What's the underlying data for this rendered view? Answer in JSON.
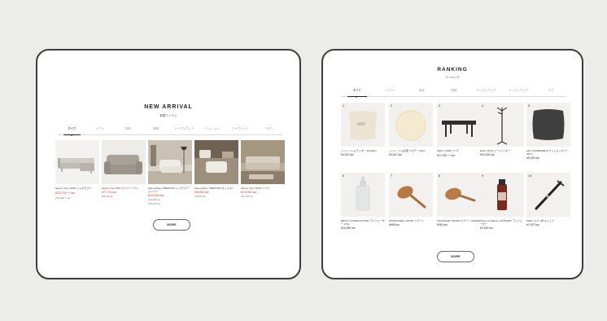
{
  "new_arrival": {
    "title": "NEW ARRIVAL",
    "subtitle": "新着アイテム",
    "tabs": [
      "すべて",
      "ソファ",
      "収納",
      "照明",
      "テーブルウェア",
      "クッション",
      "ファブリック",
      "ラグ"
    ],
    "products": [
      {
        "name": "Sea by Yoo | CPOL シャオラプソ",
        "price": "¥221,700 〜 tax",
        "orig": "¥254,000 〜 tax"
      },
      {
        "name": "Sea by Yoo | POL ワンシーソファ",
        "price": "¥77,710 tax",
        "orig": "¥96,440 tax"
      },
      {
        "name": "Sea by Bee | PREPOSO シングルアームソファ",
        "price": "¥101,500 tax",
        "orig": "¥134,000 tax",
        "note": "¥109,000 tax"
      },
      {
        "name": "Sea by Bee | PREPOSO オットマン",
        "price": "¥38,610 tax",
        "orig": "¥49,500 tax"
      },
      {
        "name": "Sea by Yoo | SCAT ソファ",
        "price": "¥176,900 tax",
        "orig": "¥211,900 tax"
      }
    ],
    "more_label": "MORE"
  },
  "ranking": {
    "title": "RANKING",
    "subtitle": "ランキング",
    "tabs": [
      "すべて",
      "ソファ",
      "収納",
      "照明",
      "テーブルウェア",
      "キッチンウェア",
      "ラグ"
    ],
    "products": [
      {
        "rank": "1",
        "name": "ノンレーシヨ ランダー 40×40cm",
        "price": "¥4,510 tax"
      },
      {
        "rank": "2",
        "name": "ノンレーシヨ丸型 フロアー 40cm",
        "price": "¥4,510 tax"
      },
      {
        "rank": "3",
        "name": "Kitoki | CIDR ベンチ",
        "price": "¥27,900 〜 tax"
      },
      {
        "rank": "4",
        "name": "kitoki | ROS コートハンガー",
        "price": "¥30,000 tax"
      },
      {
        "rank": "5",
        "name": "sahi | RUMBLEBOX クッションカバー 45cm",
        "price": "¥5,200 tax"
      },
      {
        "rank": "6",
        "name": "EBAYO | DORICAN White ディフューザー 37ml",
        "price": "¥26,950 tax"
      },
      {
        "rank": "7",
        "name": "WOODLNIEE | WOOD スプーン",
        "price": "¥858 tax"
      },
      {
        "rank": "8",
        "name": "KIKUKOHM | WOOD スプーン CASE30",
        "price": "¥990 tax"
      },
      {
        "rank": "9",
        "name": "Scope of Nature | ALPINAMY ディフューザー",
        "price": "¥2,530 tax"
      },
      {
        "rank": "10",
        "name": "ORE | ワイン用 キャップ",
        "price": "¥1,870 tax"
      }
    ],
    "more_label": "MORE"
  },
  "colors": {
    "accent_price": "#c23b3b",
    "frame": "#3c3c3c",
    "background": "#ececea"
  }
}
